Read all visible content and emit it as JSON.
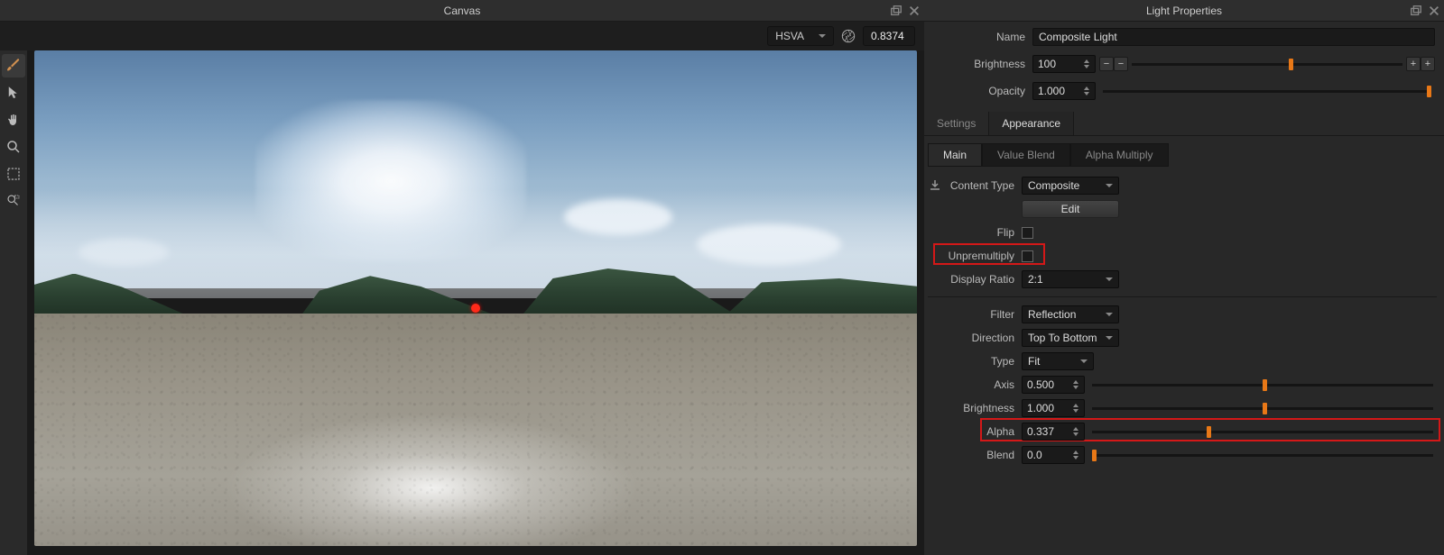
{
  "canvas": {
    "title": "Canvas",
    "colorspace": "HSVA",
    "exposure": "0.8374",
    "tools": [
      "brush",
      "pointer",
      "hand",
      "zoom",
      "marquee",
      "zoom-region"
    ]
  },
  "properties": {
    "title": "Light Properties",
    "name_label": "Name",
    "name_value": "Composite Light",
    "brightness_label": "Brightness",
    "brightness_value": "100",
    "brightness_slider_pos": 0.58,
    "opacity_label": "Opacity",
    "opacity_value": "1.000",
    "opacity_slider_pos": 1.0,
    "tabs": {
      "settings": "Settings",
      "appearance": "Appearance",
      "active": "appearance"
    },
    "subtabs": {
      "main": "Main",
      "value_blend": "Value Blend",
      "alpha_multiply": "Alpha Multiply",
      "active": "main"
    },
    "content_type_label": "Content Type",
    "content_type_value": "Composite",
    "edit_label": "Edit",
    "flip_label": "Flip",
    "flip_checked": false,
    "unpremultiply_label": "Unpremultiply",
    "unpremultiply_checked": false,
    "display_ratio_label": "Display Ratio",
    "display_ratio_value": "2:1",
    "filter_label": "Filter",
    "filter_value": "Reflection",
    "direction_label": "Direction",
    "direction_value": "Top To Bottom",
    "type_label": "Type",
    "type_value": "Fit",
    "axis_label": "Axis",
    "axis_value": "0.500",
    "axis_slider_pos": 0.5,
    "brightness2_label": "Brightness",
    "brightness2_value": "1.000",
    "brightness2_slider_pos": 0.5,
    "alpha_label": "Alpha",
    "alpha_value": "0.337",
    "alpha_slider_pos": 0.337,
    "blend_label": "Blend",
    "blend_value": "0.0",
    "blend_slider_pos": 0.0
  }
}
